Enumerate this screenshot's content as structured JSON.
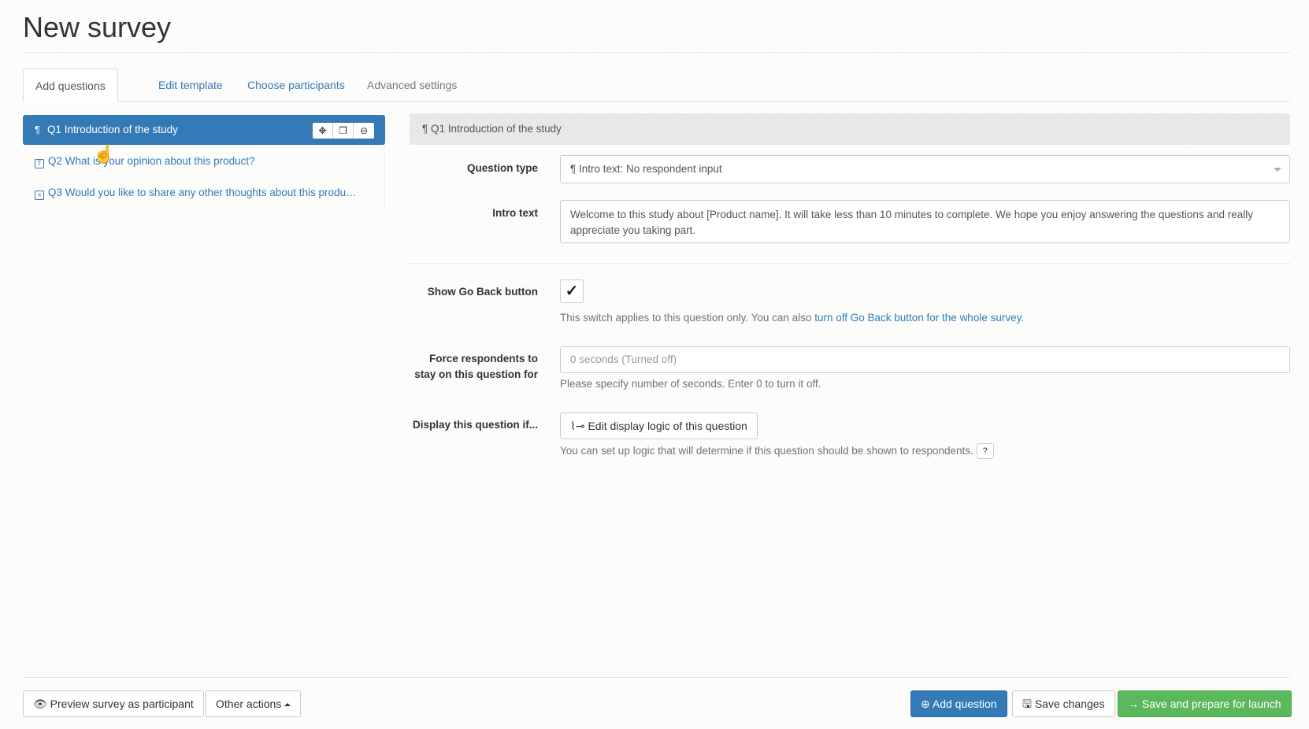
{
  "page": {
    "title": "New survey"
  },
  "tabs": [
    {
      "label": "Add questions"
    },
    {
      "label": "Edit template"
    },
    {
      "label": "Choose participants"
    },
    {
      "label": "Advanced settings"
    }
  ],
  "questions": [
    {
      "number": "Q1",
      "text": "Introduction of the study"
    },
    {
      "number": "Q2",
      "text": "What is your opinion about this product?"
    },
    {
      "number": "Q3",
      "text": "Would you like to share any other thoughts about this produ…"
    }
  ],
  "panel": {
    "header": "Q1  Introduction of the study",
    "question_type_label": "Question type",
    "question_type_value": "Intro text: No respondent input",
    "intro_text_label": "Intro text",
    "intro_text_value": "Welcome to this study about [Product name]. It will take less than 10 minutes to complete. We hope you enjoy answering the questions and really appreciate you taking part.",
    "go_back_label": "Show Go Back button",
    "go_back_checked": "✓",
    "go_back_help_prefix": "This switch applies to this question only. You can also ",
    "go_back_help_link": "turn off Go Back button for the whole survey",
    "go_back_help_suffix": ".",
    "force_label": "Force respondents to stay on this question for",
    "force_placeholder": "0 seconds (Turned off)",
    "force_help": "Please specify number of seconds. Enter 0 to turn it off.",
    "display_label": "Display this question if...",
    "display_button": "Edit display logic of this question",
    "display_help": "You can set up logic that will determine if this question should be shown to respondents.",
    "help_icon": "?"
  },
  "footer": {
    "preview": "Preview survey as participant",
    "other_actions": "Other actions",
    "add_question": "Add question",
    "save_changes": "Save changes",
    "save_launch": "Save and prepare for launch"
  },
  "colors": {
    "primary": "#337ab7",
    "success": "#5cb85c"
  }
}
